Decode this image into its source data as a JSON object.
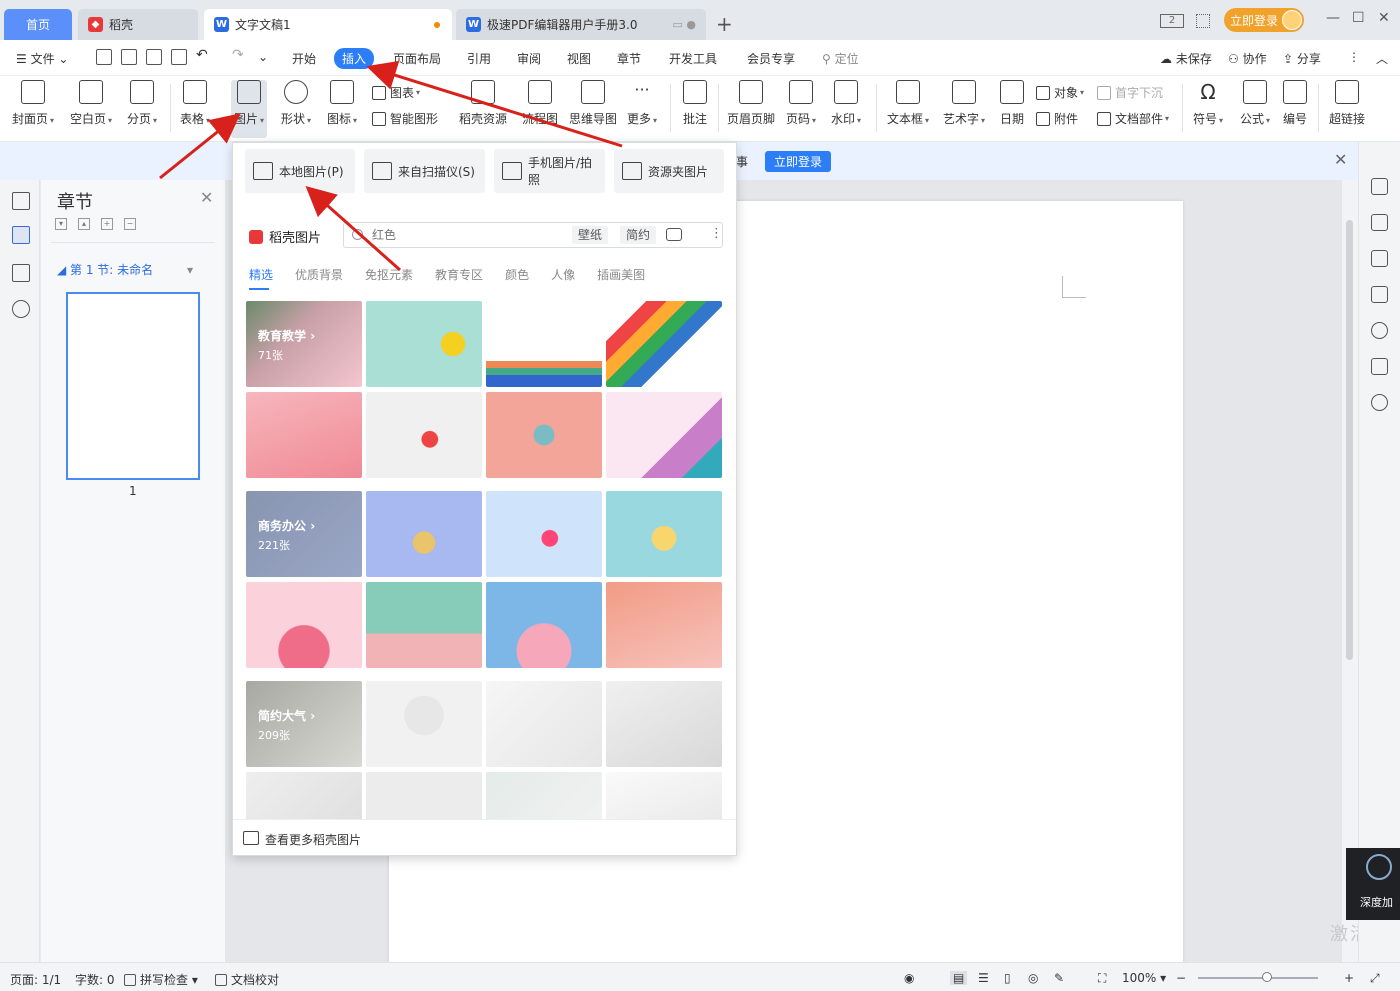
{
  "tabs": {
    "home": "首页",
    "daoke": "稻壳",
    "doc": "文字文稿1",
    "pdf": "极速PDF编辑器用户手册3.0"
  },
  "titlebar": {
    "login": "立即登录",
    "layout_badge": "2"
  },
  "menu": {
    "file": "文件",
    "items": [
      "开始",
      "插入",
      "页面布局",
      "引用",
      "审阅",
      "视图",
      "章节",
      "开发工具",
      "会员专享"
    ],
    "search": "定位",
    "unsaved": "未保存",
    "collab": "协作",
    "share": "分享"
  },
  "ribbon": {
    "cover": "封面页",
    "blank": "空白页",
    "pagebreak": "分页",
    "table": "表格",
    "picture": "图片",
    "shape": "形状",
    "icon": "图标",
    "chart": "图表",
    "smartart": "智能图形",
    "daoke_res": "稻壳资源",
    "flow": "流程图",
    "mindmap": "思维导图",
    "more": "更多",
    "comment": "批注",
    "header_footer": "页眉页脚",
    "page_num": "页码",
    "watermark": "水印",
    "textbox": "文本框",
    "wordart": "艺术字",
    "date": "日期",
    "object": "对象",
    "dropcap": "首字下沉",
    "attachment": "附件",
    "docpart": "文档部件",
    "symbol": "符号",
    "formula": "公式",
    "numbering": "编号",
    "hyperlink": "超链接"
  },
  "notice": {
    "text": "事",
    "button": "立即登录"
  },
  "chapter": {
    "title": "章节",
    "section": "第 1 节: 未命名",
    "page_number": "1"
  },
  "dropdown": {
    "sources": [
      "本地图片(P)",
      "来自扫描仪(S)",
      "手机图片/拍照",
      "资源夹图片"
    ],
    "brand": "稻壳图片",
    "search_placeholder": "红色",
    "tags": [
      "壁纸",
      "简约"
    ],
    "categories": [
      "精选",
      "优质背景",
      "免抠元素",
      "教育专区",
      "颜色",
      "人像",
      "插画美图"
    ],
    "groups": [
      {
        "label": "教育教学",
        "count": "71张"
      },
      {
        "label": "商务办公",
        "count": "221张"
      },
      {
        "label": "简约大气",
        "count": "209张"
      }
    ],
    "footer": "查看更多稻壳图片"
  },
  "deep_accel": "深度加",
  "watermark_text": "激活 W",
  "status": {
    "page": "页面: 1/1",
    "words": "字数: 0",
    "spell": "拼写检查",
    "proof": "文档校对",
    "zoom": "100%"
  }
}
